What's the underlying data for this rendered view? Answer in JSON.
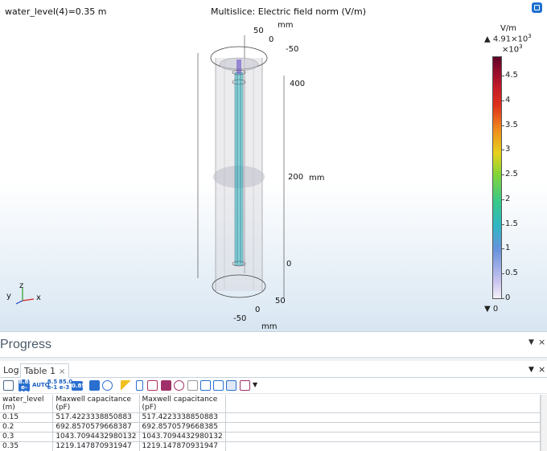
{
  "graphics": {
    "parameter_label": "water_level(4)=0.35 m",
    "title": "Multislice: Electric field norm (V/m)",
    "top_ellipse_labels": {
      "fifty": "50",
      "zero": "0",
      "minus_fifty": "-50",
      "mm": "mm"
    },
    "bottom_ellipse_labels": {
      "fifty": "50",
      "zero": "0",
      "minus_fifty": "-50",
      "mm": "mm"
    },
    "z_axis_labels": {
      "z400": "400",
      "z200": "200",
      "z0": "0",
      "mm": "mm"
    },
    "triad": {
      "x": "x",
      "y": "y",
      "z": "z"
    }
  },
  "colorbar": {
    "unit": "V/m",
    "max_marker": "▲",
    "max_value": "4.91×10",
    "max_exp": "3",
    "scale_label": "×10",
    "scale_exp": "3",
    "ticks": [
      "4.5",
      "4",
      "3.5",
      "3",
      "2.5",
      "2",
      "1.5",
      "1",
      "0.5",
      "0"
    ],
    "tick_values": [
      4.5,
      4,
      3.5,
      3,
      2.5,
      2,
      1.5,
      1,
      0.5,
      0
    ],
    "range": [
      0,
      4.91
    ],
    "min_marker": "▼",
    "min_value": "0"
  },
  "progress": {
    "title": "Progress",
    "menu_icon": "dropdown-triangle-icon",
    "close_icon": "close-icon"
  },
  "tabs": {
    "items": [
      {
        "label": "Log"
      },
      {
        "label": "Table 1",
        "close": "×"
      }
    ],
    "menu_icon": "dropdown-triangle-icon"
  },
  "toolbar": {
    "icons": [
      "table-icon",
      "decimal-format-icon",
      "auto-format-icon",
      "precision-format-icon",
      "engineering-format-icon",
      "full-precision-icon",
      "table-grid-icon",
      "sync-icon",
      "filter-icon",
      "clear-icon",
      "export-table-icon",
      "color-table-icon",
      "heat-map-icon",
      "copy-icon",
      "copy-with-headers-icon",
      "copy-all-icon",
      "copy-full-precision-icon",
      "table-settings-icon"
    ],
    "text_icons": {
      "auto": "AUTO",
      "fmt1a": "8.85",
      "fmt1b": "e-12",
      "fmt2a": "8.5",
      "fmt2b": "e-1",
      "fmt3a": "85.0",
      "fmt3b": "e-3",
      "fmt4": "0.85"
    }
  },
  "table": {
    "columns": [
      "water_level (m)",
      "Maxwell capacitance (pF)",
      "Maxwell capacitance (pF)"
    ],
    "rows": [
      [
        "0.15",
        "517.4223338850883",
        "517.4223338850883"
      ],
      [
        "0.2",
        "692.8570579668387",
        "692.8570579668385"
      ],
      [
        "0.3",
        "1043.7094432980132",
        "1043.7094432980132"
      ],
      [
        "0.35",
        "1219.147870931947",
        "1219.147870931947"
      ]
    ]
  },
  "colors": {
    "accent": "#1b5fc1",
    "graphics_bg_bottom": "#d8e6f2",
    "electrode": "#29b7c6"
  }
}
